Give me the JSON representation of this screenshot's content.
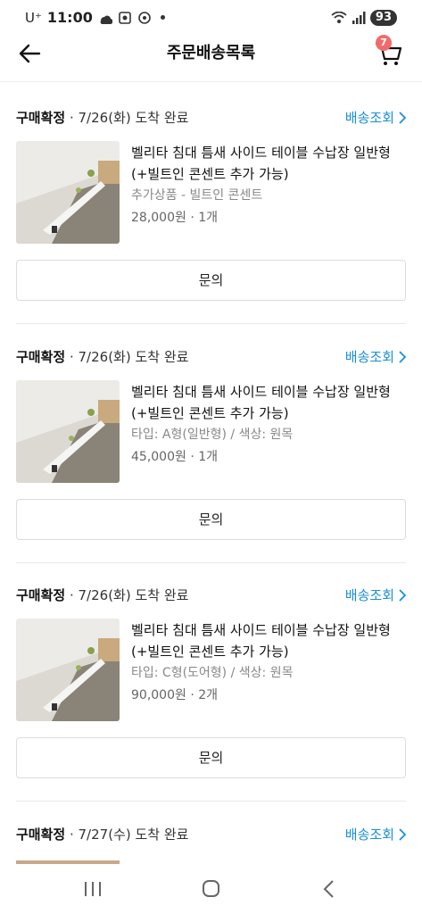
{
  "status_bar": {
    "carrier": "U⁺",
    "time": "11:00",
    "battery": "93"
  },
  "header": {
    "title": "주문배송목록",
    "cart_count": "7"
  },
  "orders": [
    {
      "status": "구매확정",
      "date": " · 7/26(화) 도착 완료",
      "track_label": "배송조회",
      "product_name": "벨리타 침대 틈새 사이드 테이블 수납장 일반형 (+빌트인 콘센트 추가 가능)",
      "option": "추가상품 - 빌트인 콘센트",
      "price": "28,000원 · 1개",
      "inquiry_label": "문의"
    },
    {
      "status": "구매확정",
      "date": " · 7/26(화) 도착 완료",
      "track_label": "배송조회",
      "product_name": "벨리타 침대 틈새 사이드 테이블 수납장 일반형 (+빌트인 콘센트 추가 가능)",
      "option": "타입: A형(일반형) / 색상: 원목",
      "price": "45,000원 · 1개",
      "inquiry_label": "문의"
    },
    {
      "status": "구매확정",
      "date": " · 7/26(화) 도착 완료",
      "track_label": "배송조회",
      "product_name": "벨리타 침대 틈새 사이드 테이블 수납장 일반형 (+빌트인 콘센트 추가 가능)",
      "option": "타입: C형(도어형) / 색상: 원목",
      "price": "90,000원 · 2개",
      "inquiry_label": "문의"
    },
    {
      "status": "구매확정",
      "date": " · 7/27(수) 도착 완료",
      "track_label": "배송조회"
    }
  ],
  "colors": {
    "accent_link": "#1a8fd6",
    "badge": "#f26b6b"
  },
  "icons": {
    "back": "arrow-left-icon",
    "cart": "shopping-cart-icon",
    "track": "chevron-right-icon"
  }
}
